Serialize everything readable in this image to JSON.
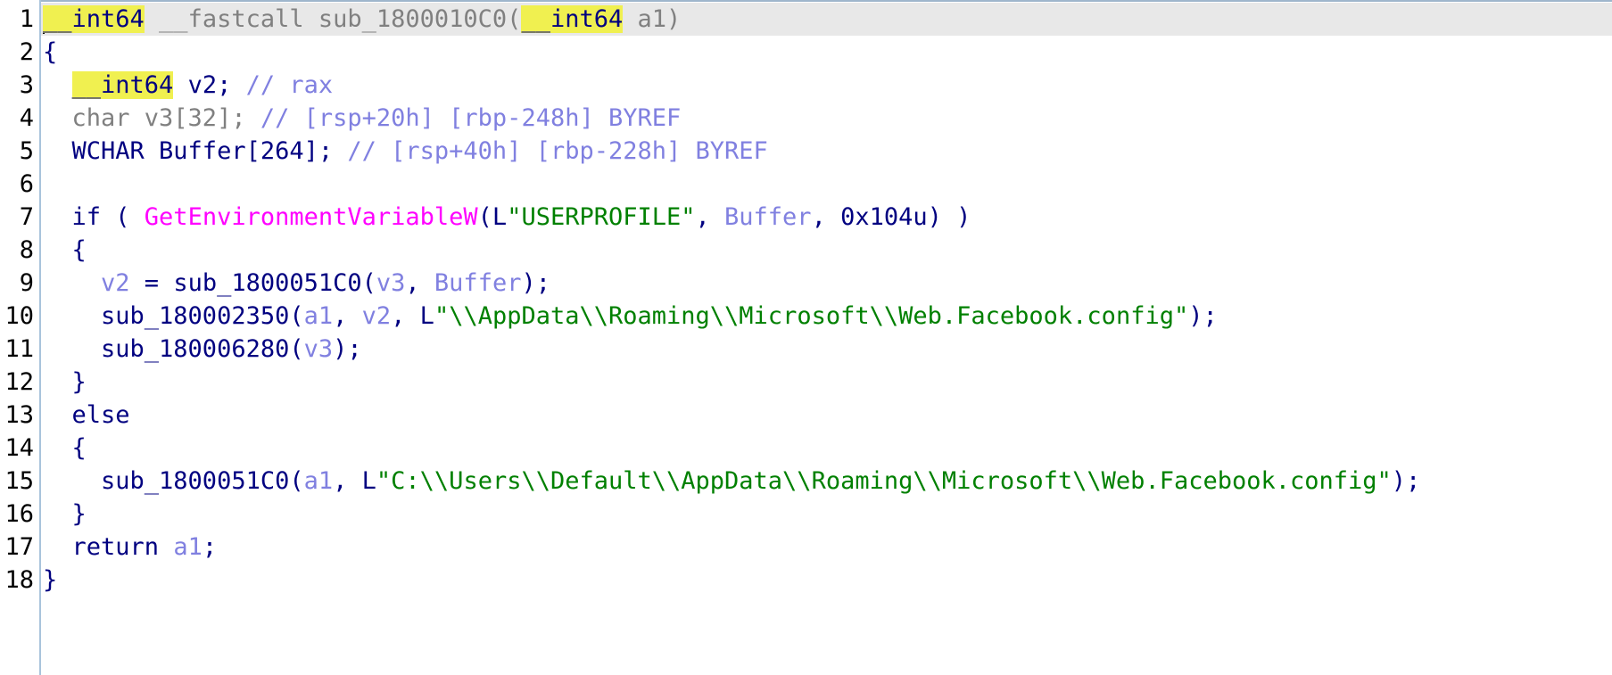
{
  "editor": {
    "lines": [
      {
        "n": "1",
        "current": true,
        "tokens": [
          {
            "t": "__int64",
            "c": "hl"
          },
          {
            "t": " __fastcall sub_1800010C0(",
            "c": "gray"
          },
          {
            "t": "__int64",
            "c": "hl"
          },
          {
            "t": " a1)",
            "c": "gray"
          }
        ]
      },
      {
        "n": "2",
        "tokens": [
          {
            "t": "{",
            "c": "default"
          }
        ]
      },
      {
        "n": "3",
        "tokens": [
          {
            "t": "  ",
            "c": "default"
          },
          {
            "t": "__int64",
            "c": "hl"
          },
          {
            "t": " v2; ",
            "c": "default"
          },
          {
            "t": "// rax",
            "c": "comment"
          }
        ]
      },
      {
        "n": "4",
        "tokens": [
          {
            "t": "  char v3[32]; ",
            "c": "gray"
          },
          {
            "t": "// [rsp+20h] [rbp-248h] BYREF",
            "c": "comment"
          }
        ]
      },
      {
        "n": "5",
        "tokens": [
          {
            "t": "  WCHAR Buffer[264]; ",
            "c": "default"
          },
          {
            "t": "// [rsp+40h] [rbp-228h] BYREF",
            "c": "comment"
          }
        ]
      },
      {
        "n": "6",
        "tokens": [
          {
            "t": "",
            "c": "default"
          }
        ]
      },
      {
        "n": "7",
        "tokens": [
          {
            "t": "  if ( ",
            "c": "default"
          },
          {
            "t": "GetEnvironmentVariableW",
            "c": "api"
          },
          {
            "t": "(L",
            "c": "default"
          },
          {
            "t": "\"USERPROFILE\"",
            "c": "str"
          },
          {
            "t": ", ",
            "c": "default"
          },
          {
            "t": "Buffer",
            "c": "var"
          },
          {
            "t": ", 0x104u) )",
            "c": "default"
          }
        ]
      },
      {
        "n": "8",
        "tokens": [
          {
            "t": "  {",
            "c": "default"
          }
        ]
      },
      {
        "n": "9",
        "tokens": [
          {
            "t": "    ",
            "c": "default"
          },
          {
            "t": "v2",
            "c": "var"
          },
          {
            "t": " = sub_1800051C0(",
            "c": "default"
          },
          {
            "t": "v3",
            "c": "var"
          },
          {
            "t": ", ",
            "c": "default"
          },
          {
            "t": "Buffer",
            "c": "var"
          },
          {
            "t": ");",
            "c": "default"
          }
        ]
      },
      {
        "n": "10",
        "tokens": [
          {
            "t": "    sub_180002350(",
            "c": "default"
          },
          {
            "t": "a1",
            "c": "var"
          },
          {
            "t": ", ",
            "c": "default"
          },
          {
            "t": "v2",
            "c": "var"
          },
          {
            "t": ", L",
            "c": "default"
          },
          {
            "t": "\"\\\\AppData\\\\Roaming\\\\Microsoft\\\\Web.Facebook.config\"",
            "c": "str"
          },
          {
            "t": ");",
            "c": "default"
          }
        ]
      },
      {
        "n": "11",
        "tokens": [
          {
            "t": "    sub_180006280(",
            "c": "default"
          },
          {
            "t": "v3",
            "c": "var"
          },
          {
            "t": ");",
            "c": "default"
          }
        ]
      },
      {
        "n": "12",
        "tokens": [
          {
            "t": "  }",
            "c": "default"
          }
        ]
      },
      {
        "n": "13",
        "tokens": [
          {
            "t": "  else",
            "c": "default"
          }
        ]
      },
      {
        "n": "14",
        "tokens": [
          {
            "t": "  {",
            "c": "default"
          }
        ]
      },
      {
        "n": "15",
        "tokens": [
          {
            "t": "    sub_1800051C0(",
            "c": "default"
          },
          {
            "t": "a1",
            "c": "var"
          },
          {
            "t": ", L",
            "c": "default"
          },
          {
            "t": "\"C:\\\\Users\\\\Default\\\\AppData\\\\Roaming\\\\Microsoft\\\\Web.Facebook.config\"",
            "c": "str"
          },
          {
            "t": ");",
            "c": "default"
          }
        ]
      },
      {
        "n": "16",
        "tokens": [
          {
            "t": "  }",
            "c": "default"
          }
        ]
      },
      {
        "n": "17",
        "tokens": [
          {
            "t": "  return ",
            "c": "default"
          },
          {
            "t": "a1",
            "c": "var"
          },
          {
            "t": ";",
            "c": "default"
          }
        ]
      },
      {
        "n": "18",
        "tokens": [
          {
            "t": "}",
            "c": "default"
          }
        ]
      }
    ]
  },
  "colors": {
    "keyword_highlight": "#f0f050",
    "string": "#008000",
    "api_call": "#ff00ff",
    "variable": "#8080e0",
    "default_text": "#000080",
    "gray_text": "#808080",
    "current_line": "#e8e8e8"
  }
}
